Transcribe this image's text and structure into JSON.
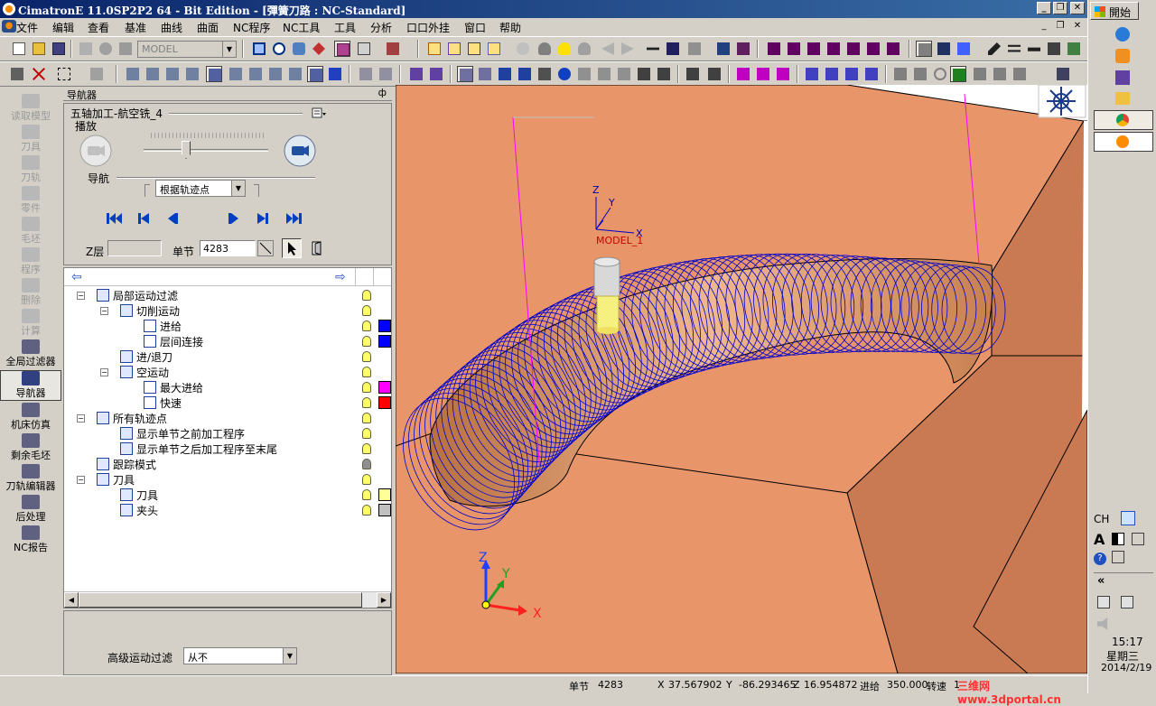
{
  "window": {
    "title": "CimatronE 11.0SP2P2 64 - Bit Edition - [彈簧刀路 : NC-Standard]",
    "min_glyph": "_",
    "restore_glyph": "❐",
    "close_glyph": "✕"
  },
  "menu": {
    "items": [
      "文件",
      "编辑",
      "查看",
      "基准",
      "曲线",
      "曲面",
      "NC程序",
      "NC工具",
      "工具",
      "分析",
      "口口外挂",
      "窗口",
      "帮助"
    ]
  },
  "toolbar1": {
    "model_combo": "MODEL"
  },
  "left_tools": [
    {
      "label": "读取模型",
      "icon": "read-model-icon",
      "disabled": true
    },
    {
      "label": "刀具",
      "icon": "tool-icon",
      "disabled": true
    },
    {
      "label": "刀轨",
      "icon": "toolpath-icon",
      "disabled": true
    },
    {
      "label": "零件",
      "icon": "part-icon",
      "disabled": true
    },
    {
      "label": "毛坯",
      "icon": "stock-icon",
      "disabled": true
    },
    {
      "label": "程序",
      "icon": "program-icon",
      "disabled": true
    },
    {
      "label": "删除",
      "icon": "delete-icon",
      "disabled": true
    },
    {
      "label": "计算",
      "icon": "compute-icon",
      "disabled": true
    },
    {
      "label": "全局过滤器",
      "icon": "global-filter-icon",
      "disabled": false
    },
    {
      "label": "导航器",
      "icon": "navigator-icon",
      "disabled": false,
      "active": true
    },
    {
      "label": "机床仿真",
      "icon": "machine-sim-icon",
      "disabled": false
    },
    {
      "label": "剩余毛坯",
      "icon": "remaining-stock-icon",
      "disabled": false
    },
    {
      "label": "刀轨编辑器",
      "icon": "toolpath-editor-icon",
      "disabled": false
    },
    {
      "label": "后处理",
      "icon": "post-process-icon",
      "disabled": false
    },
    {
      "label": "NC报告",
      "icon": "nc-report-icon",
      "disabled": false
    }
  ],
  "navigator": {
    "header": "导航器",
    "pin_glyph": "ф",
    "procedure_name": "五轴加工-航空铣_4",
    "play_label": "播放",
    "nav_label": "导航",
    "nav_mode": "根据轨迹点",
    "zlayer_label": "Z层",
    "zlayer_value": "",
    "block_label": "单节",
    "block_value": "4283",
    "advanced_filter_label": "高级运动过滤",
    "advanced_filter_value": "从不",
    "tree": [
      {
        "label": "局部运动过滤",
        "level": 1,
        "expander": "−",
        "bulb": "#ffff66",
        "swatch": null
      },
      {
        "label": "切削运动",
        "level": 2,
        "expander": "−",
        "bulb": "#ffff66",
        "swatch": null
      },
      {
        "label": "进给",
        "level": 3,
        "expander": null,
        "bulb": "#ffff66",
        "swatch": "#0000ff"
      },
      {
        "label": "层间连接",
        "level": 3,
        "expander": null,
        "bulb": "#ffff66",
        "swatch": "#0000ff"
      },
      {
        "label": "进/退刀",
        "level": 2,
        "expander": null,
        "bulb": "#ffff66",
        "swatch": null
      },
      {
        "label": "空运动",
        "level": 2,
        "expander": "−",
        "bulb": "#ffff66",
        "swatch": null
      },
      {
        "label": "最大进给",
        "level": 3,
        "expander": null,
        "bulb": "#ffff66",
        "swatch": "#ff00ff"
      },
      {
        "label": "快速",
        "level": 3,
        "expander": null,
        "bulb": "#ffff66",
        "swatch": "#ff0000"
      },
      {
        "label": "所有轨迹点",
        "level": 1,
        "expander": "−",
        "bulb": "#ffff66",
        "swatch": null
      },
      {
        "label": "显示单节之前加工程序",
        "level": 2,
        "expander": null,
        "bulb": "#ffff66",
        "swatch": null
      },
      {
        "label": "显示单节之后加工程序至末尾",
        "level": 2,
        "expander": null,
        "bulb": "#ffff66",
        "swatch": null
      },
      {
        "label": "跟踪模式",
        "level": 1,
        "expander": null,
        "bulb": "#909090",
        "swatch": null
      },
      {
        "label": "刀具",
        "level": 1,
        "expander": "−",
        "bulb": "#ffff66",
        "swatch": null
      },
      {
        "label": "刀具",
        "level": 2,
        "expander": null,
        "bulb": "#ffff66",
        "swatch": "#ffff99"
      },
      {
        "label": "夹头",
        "level": 2,
        "expander": null,
        "bulb": "#ffff66",
        "swatch": "#c0c0c0"
      }
    ]
  },
  "viewport": {
    "model_label": "MODEL_1",
    "axis_x": "X",
    "axis_y": "Y",
    "axis_z": "Z",
    "colors": {
      "stock_top": "#e8956a",
      "stock_side": "#c97a52",
      "toolpath": "#0000cc",
      "rapid": "#ff00ff"
    }
  },
  "status": {
    "block_label": "单节",
    "block_value": "4283",
    "x_label": "X",
    "x_value": "37.567902",
    "y_label": "Y",
    "y_value": "-86.293465",
    "z_label": "Z",
    "z_value": "16.954872",
    "feed_label": "进给",
    "feed_value": "350.000",
    "speed_label": "转速",
    "speed_value": "1",
    "watermark": "三维网www.3dportal.cn"
  },
  "taskbar": {
    "start_label": "開始",
    "lang": "CH",
    "collapse": "«",
    "time": "15:17",
    "weekday": "星期三",
    "date": "2014/2/19"
  }
}
